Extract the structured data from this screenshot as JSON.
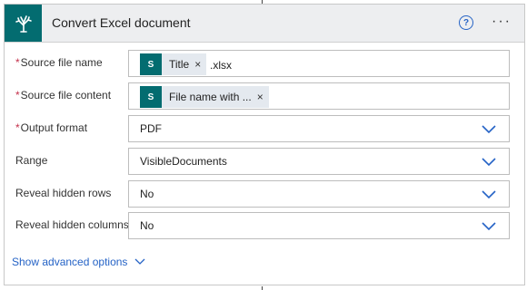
{
  "header": {
    "title": "Convert Excel document",
    "help_symbol": "?",
    "more_symbol": "···",
    "icon": "sharepoint-tree-icon"
  },
  "fields": {
    "source_file_name": {
      "label": "Source file name",
      "required": "*",
      "token": {
        "icon_text": "S",
        "label": "Title",
        "remove": "×"
      },
      "suffix": ".xlsx"
    },
    "source_file_content": {
      "label": "Source file content",
      "required": "*",
      "token": {
        "icon_text": "S",
        "label": "File name with ...",
        "remove": "×"
      }
    },
    "output_format": {
      "label": "Output format",
      "required": "*",
      "value": "PDF"
    },
    "range": {
      "label": "Range",
      "value": "VisibleDocuments"
    },
    "reveal_hidden_rows": {
      "label": "Reveal hidden rows",
      "value": "No"
    },
    "reveal_hidden_columns": {
      "label": "Reveal hidden columns",
      "value": "No"
    }
  },
  "advanced_options": {
    "label": "Show advanced options"
  },
  "colors": {
    "accent": "#2563c6",
    "brand": "#036c70",
    "required": "#c4314b",
    "header_bg": "#edeef0"
  }
}
